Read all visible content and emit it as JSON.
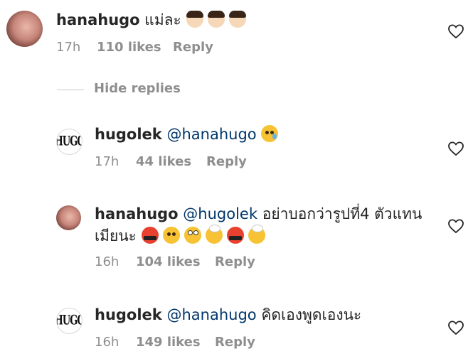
{
  "comments": [
    {
      "username": "hanahugo",
      "text": "แม่ละ",
      "emoji_names": [
        "woman-facepalming",
        "woman-facepalming",
        "woman-facepalming"
      ],
      "time": "17h",
      "likes": "110 likes",
      "reply_label": "Reply"
    },
    {
      "username": "hugolek",
      "mention": "@hanahugo",
      "text": "",
      "emoji_names": [
        "crying-face"
      ],
      "time": "17h",
      "likes": "44 likes",
      "reply_label": "Reply"
    },
    {
      "username": "hanahugo",
      "mention": "@hugolek",
      "text": "อย่าบอกว่ารูปที่4 ตัวแทน",
      "text_line2": "เมียนะ",
      "emoji_names": [
        "face-with-symbols-on-mouth",
        "face-with-steam-from-nose",
        "face-with-rolling-eyes",
        "exploding-head",
        "face-with-symbols-on-mouth",
        "exploding-head"
      ],
      "time": "16h",
      "likes": "104 likes",
      "reply_label": "Reply"
    },
    {
      "username": "hugolek",
      "mention": "@hanahugo",
      "text": "คิดเองพูดเองนะ",
      "time": "16h",
      "likes": "149 likes",
      "reply_label": "Reply"
    }
  ],
  "hide_replies_label": "Hide replies",
  "hugo_logo_text": "HUGO",
  "colors": {
    "text": "#262626",
    "meta": "#8e8e8e",
    "mention": "#00376b",
    "divider": "#c7c7c7"
  }
}
